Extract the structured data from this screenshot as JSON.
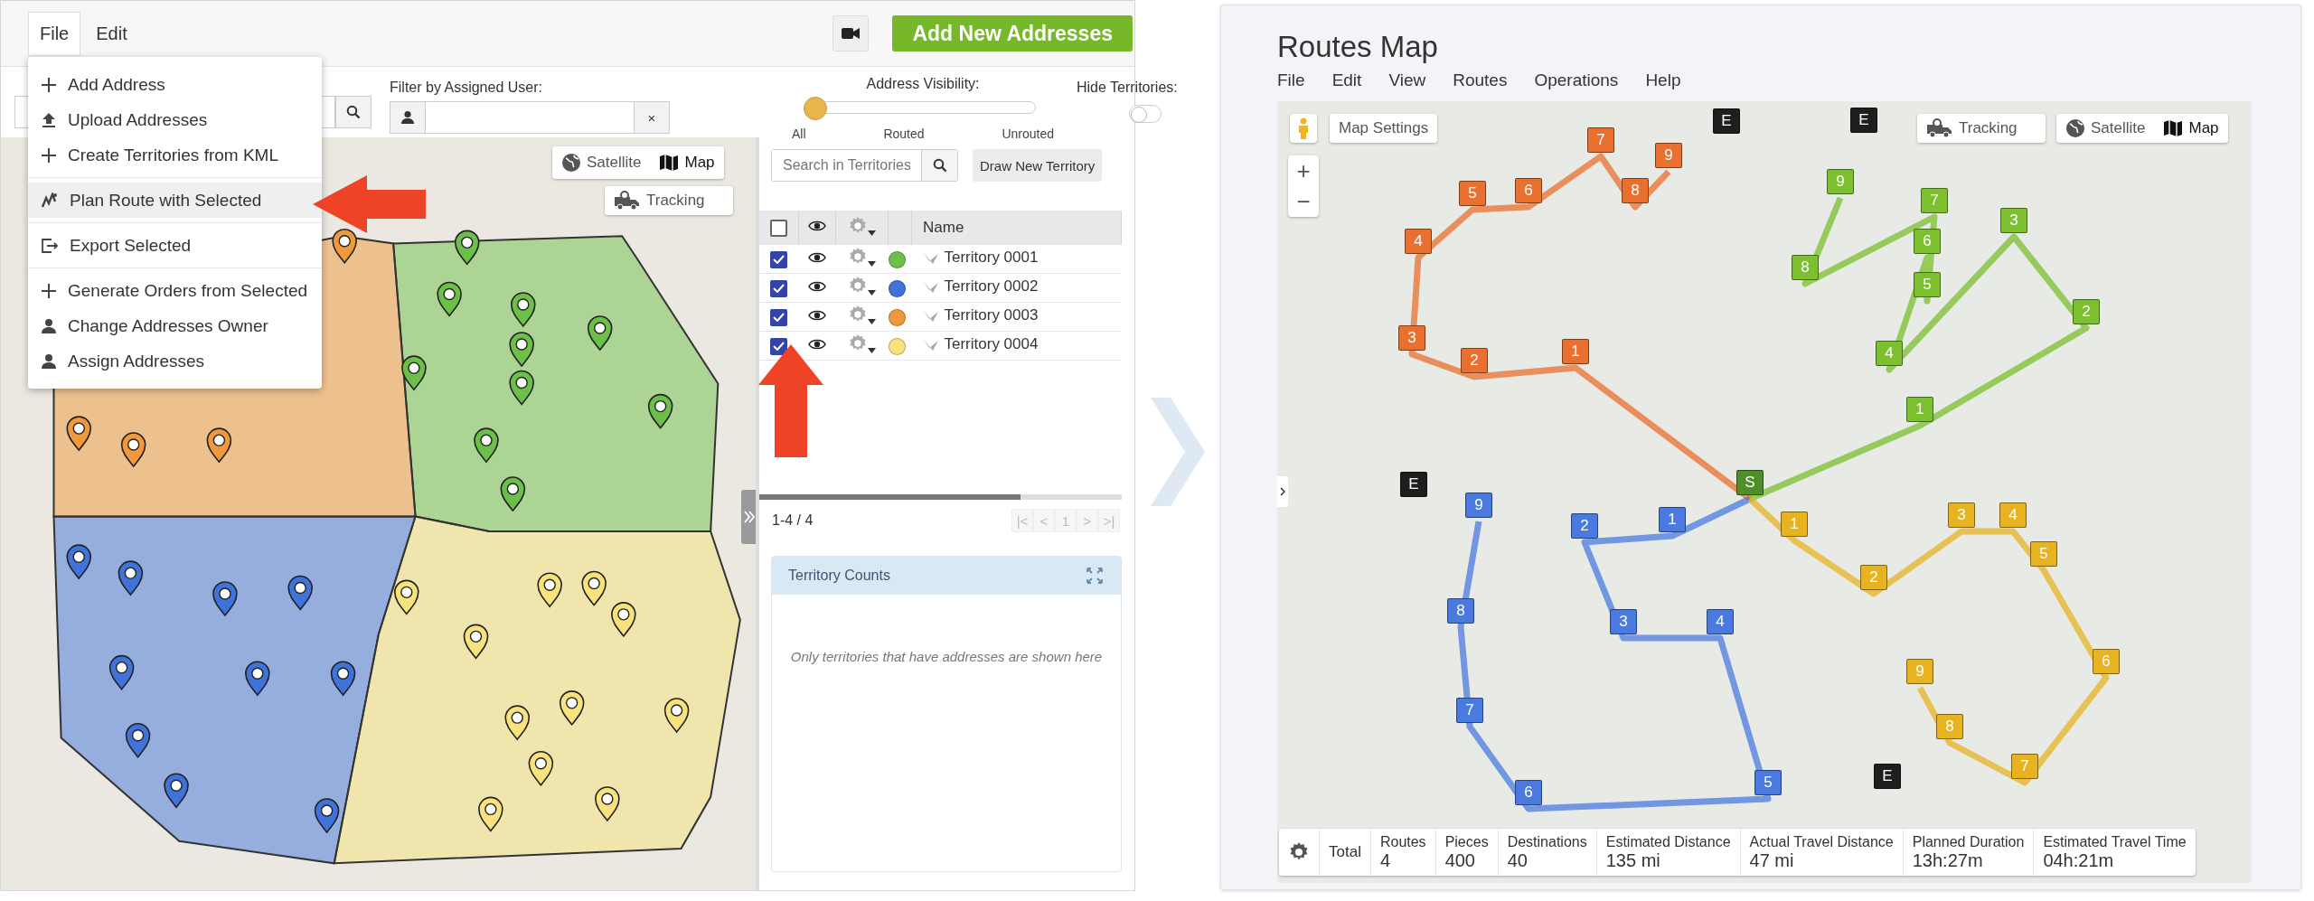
{
  "left_app": {
    "menubar": [
      {
        "label": "File",
        "selected": true
      },
      {
        "label": "Edit",
        "selected": false
      }
    ],
    "add_button": "Add New Addresses",
    "file_menu": [
      {
        "items": [
          {
            "label": "Add Address",
            "kind": "plus",
            "selected": false
          },
          {
            "label": "Upload Addresses",
            "kind": "upload",
            "selected": false
          },
          {
            "label": "Create Territories from KML",
            "kind": "plus",
            "selected": false
          }
        ]
      },
      {
        "items": [
          {
            "label": "Plan Route with Selected",
            "kind": "route",
            "selected": true
          }
        ]
      },
      {
        "items": [
          {
            "label": "Export Selected",
            "kind": "export",
            "selected": false
          }
        ]
      },
      {
        "items": [
          {
            "label": "Generate Orders from Selected",
            "kind": "plus",
            "selected": false
          },
          {
            "label": "Change Addresses Owner",
            "kind": "user",
            "selected": false
          },
          {
            "label": "Assign Addresses",
            "kind": "user",
            "selected": false
          }
        ]
      }
    ],
    "filter_label": "Filter by Assigned User:",
    "clear_button": "×",
    "visibility": {
      "label": "Address Visibility:",
      "level": 0,
      "stops": [
        "All",
        "Routed",
        "Unrouted"
      ]
    },
    "hide_territories": {
      "label": "Hide Territories:",
      "on": false
    },
    "map_controls": {
      "satellite": "Satellite",
      "map": "Map",
      "map_selected": true,
      "tracking": "Tracking"
    },
    "territories_panel": {
      "search_placeholder": "Search in Territories",
      "draw_button": "Draw New Territory",
      "header_name": "Name",
      "header_checked": false,
      "rows": [
        {
          "name": "Territory 0001",
          "checked": true,
          "color": "#6cc04a"
        },
        {
          "name": "Territory 0002",
          "checked": true,
          "color": "#3f73d9"
        },
        {
          "name": "Territory 0003",
          "checked": true,
          "color": "#f0993c"
        },
        {
          "name": "Territory 0004",
          "checked": true,
          "color": "#f7e27c"
        }
      ],
      "range": "1-4 / 4",
      "pager": [
        "|<",
        "<",
        "1",
        ">",
        ">|"
      ],
      "counts_title": "Territory Counts",
      "counts_empty": "Only territories that have addresses are shown here"
    }
  },
  "routes_app": {
    "title": "Routes Map",
    "menu": [
      "File",
      "Edit",
      "View",
      "Routes",
      "Operations",
      "Help"
    ],
    "map_controls": {
      "settings": "Map Settings",
      "tracking": "Tracking",
      "satellite": "Satellite",
      "map": "Map",
      "map_selected": true,
      "zoom_in": "+",
      "zoom_out": "−"
    },
    "routes": [
      {
        "color": "#e9702f",
        "stops": [
          "1",
          "2",
          "3",
          "4",
          "5",
          "6",
          "7",
          "8",
          "9"
        ]
      },
      {
        "color": "#7cbf2f",
        "stops": [
          "1",
          "2",
          "3",
          "4",
          "6",
          "5",
          "7",
          "8",
          "9"
        ]
      },
      {
        "color": "#4a7ae0",
        "stops": [
          "1",
          "2",
          "3",
          "4",
          "5",
          "6",
          "7",
          "8",
          "9"
        ]
      },
      {
        "color": "#e7b321",
        "stops": [
          "1",
          "2",
          "3",
          "4",
          "5",
          "6",
          "7",
          "8",
          "9"
        ]
      }
    ],
    "start_label": "S",
    "end_labels": [
      "E",
      "E",
      "E",
      "E"
    ],
    "totals": {
      "label": "Total",
      "columns": [
        {
          "name": "Routes",
          "value": "4"
        },
        {
          "name": "Pieces",
          "value": "400"
        },
        {
          "name": "Destinations",
          "value": "40"
        },
        {
          "name": "Estimated Distance",
          "value": "135 mi"
        },
        {
          "name": "Actual Travel Distance",
          "value": "47 mi"
        },
        {
          "name": "Planned Duration",
          "value": "13h:27m"
        },
        {
          "name": "Estimated Travel Time",
          "value": "04h:21m"
        }
      ]
    }
  }
}
